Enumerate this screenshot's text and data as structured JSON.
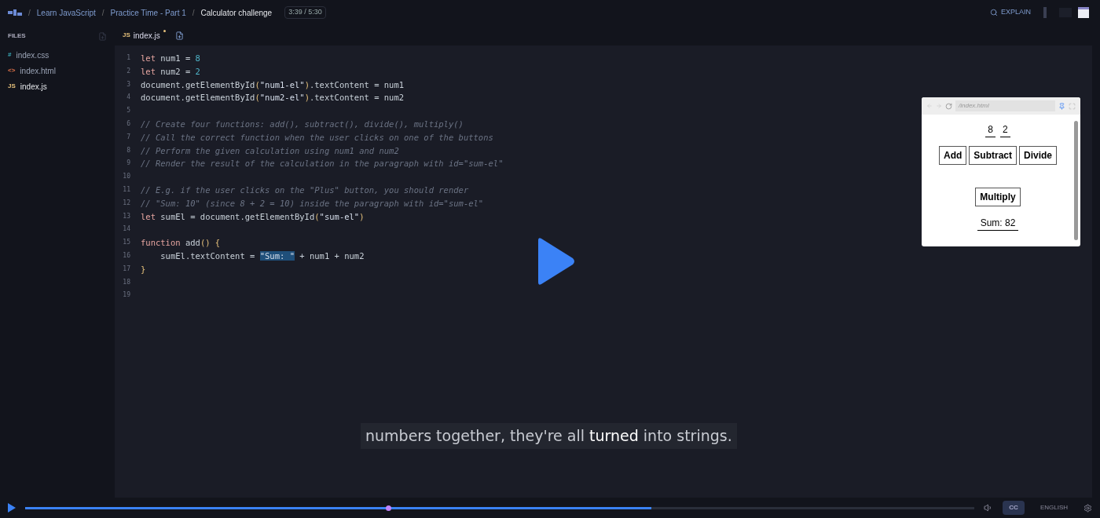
{
  "breadcrumb": {
    "separator": "/",
    "items": [
      "Learn JavaScript",
      "Practice Time - Part 1",
      "Calculator challenge"
    ]
  },
  "time": "3:39 / 5:30",
  "explain": "EXPLAIN",
  "files": {
    "title": "FILES",
    "items": [
      {
        "icon": "#",
        "kind": "css",
        "name": "index.css",
        "selected": false
      },
      {
        "icon": "<>",
        "kind": "html",
        "name": "index.html",
        "selected": false
      },
      {
        "icon": "JS",
        "kind": "js",
        "name": "index.js",
        "selected": true
      }
    ]
  },
  "tab": {
    "icon": "JS",
    "name": "index.js",
    "modified": true
  },
  "code": [
    {
      "n": "1",
      "segs": [
        {
          "kind": "keyword",
          "text": "let"
        },
        {
          "kind": "plain",
          "text": " num1 = "
        },
        {
          "kind": "number",
          "text": "8"
        }
      ]
    },
    {
      "n": "2",
      "segs": [
        {
          "kind": "keyword",
          "text": "let"
        },
        {
          "kind": "plain",
          "text": " num2 = "
        },
        {
          "kind": "number",
          "text": "2"
        }
      ]
    },
    {
      "n": "3",
      "segs": [
        {
          "kind": "plain",
          "text": "document.getElementById"
        },
        {
          "kind": "paren",
          "text": "("
        },
        {
          "kind": "string",
          "text": "\"num1-el\""
        },
        {
          "kind": "paren",
          "text": ")"
        },
        {
          "kind": "plain",
          "text": ".textContent = num1"
        }
      ]
    },
    {
      "n": "4",
      "segs": [
        {
          "kind": "plain",
          "text": "document.getElementById"
        },
        {
          "kind": "paren",
          "text": "("
        },
        {
          "kind": "string",
          "text": "\"num2-el\""
        },
        {
          "kind": "paren",
          "text": ")"
        },
        {
          "kind": "plain",
          "text": ".textContent = num2"
        }
      ]
    },
    {
      "n": "5"
    },
    {
      "n": "6",
      "segs": [
        {
          "kind": "comment",
          "text": "// Create four functions: add(), subtract(), divide(), multiply()"
        }
      ]
    },
    {
      "n": "7",
      "segs": [
        {
          "kind": "comment",
          "text": "// Call the correct function when the user clicks on one of the buttons"
        }
      ]
    },
    {
      "n": "8",
      "segs": [
        {
          "kind": "comment",
          "text": "// Perform the given calculation using num1 and num2"
        }
      ]
    },
    {
      "n": "9",
      "segs": [
        {
          "kind": "comment",
          "text": "// Render the result of the calculation in the paragraph with id=\"sum-el\""
        }
      ]
    },
    {
      "n": "10"
    },
    {
      "n": "11",
      "segs": [
        {
          "kind": "comment",
          "text": "// E.g. if the user clicks on the \"Plus\" button, you should render"
        }
      ]
    },
    {
      "n": "12",
      "segs": [
        {
          "kind": "comment",
          "text": "// \"Sum: 10\" (since 8 + 2 = 10) inside the paragraph with id=\"sum-el\""
        }
      ]
    },
    {
      "n": "13",
      "segs": [
        {
          "kind": "keyword",
          "text": "let"
        },
        {
          "kind": "plain",
          "text": " sumEl = document.getElementById"
        },
        {
          "kind": "paren",
          "text": "("
        },
        {
          "kind": "string",
          "text": "\"sum-el\""
        },
        {
          "kind": "paren",
          "text": ")"
        }
      ]
    },
    {
      "n": "14"
    },
    {
      "n": "15",
      "segs": [
        {
          "kind": "keyword",
          "text": "function"
        },
        {
          "kind": "plain",
          "text": " add"
        },
        {
          "kind": "paren",
          "text": "() {"
        }
      ]
    },
    {
      "n": "16",
      "segs": [
        {
          "kind": "plain",
          "text": "    sumEl.textContent = "
        },
        {
          "kind": "selected",
          "text": "\"Sum: \""
        },
        {
          "kind": "plain",
          "text": " + num1 + num2"
        }
      ]
    },
    {
      "n": "17",
      "segs": [
        {
          "kind": "paren",
          "text": "}"
        }
      ]
    },
    {
      "n": "18"
    },
    {
      "n": "19"
    }
  ],
  "preview": {
    "url": "/index.html",
    "numbers": [
      "8",
      "2"
    ],
    "buttons": [
      "Add",
      "Subtract",
      "Divide"
    ],
    "button_row2": [
      "Multiply"
    ],
    "sum": "Sum: 82"
  },
  "caption": {
    "before": "numbers together, they're all ",
    "bold": "turned",
    "after": " into strings."
  },
  "player": {
    "level": 0.66,
    "cc": "CC",
    "language": "ENGLISH"
  }
}
